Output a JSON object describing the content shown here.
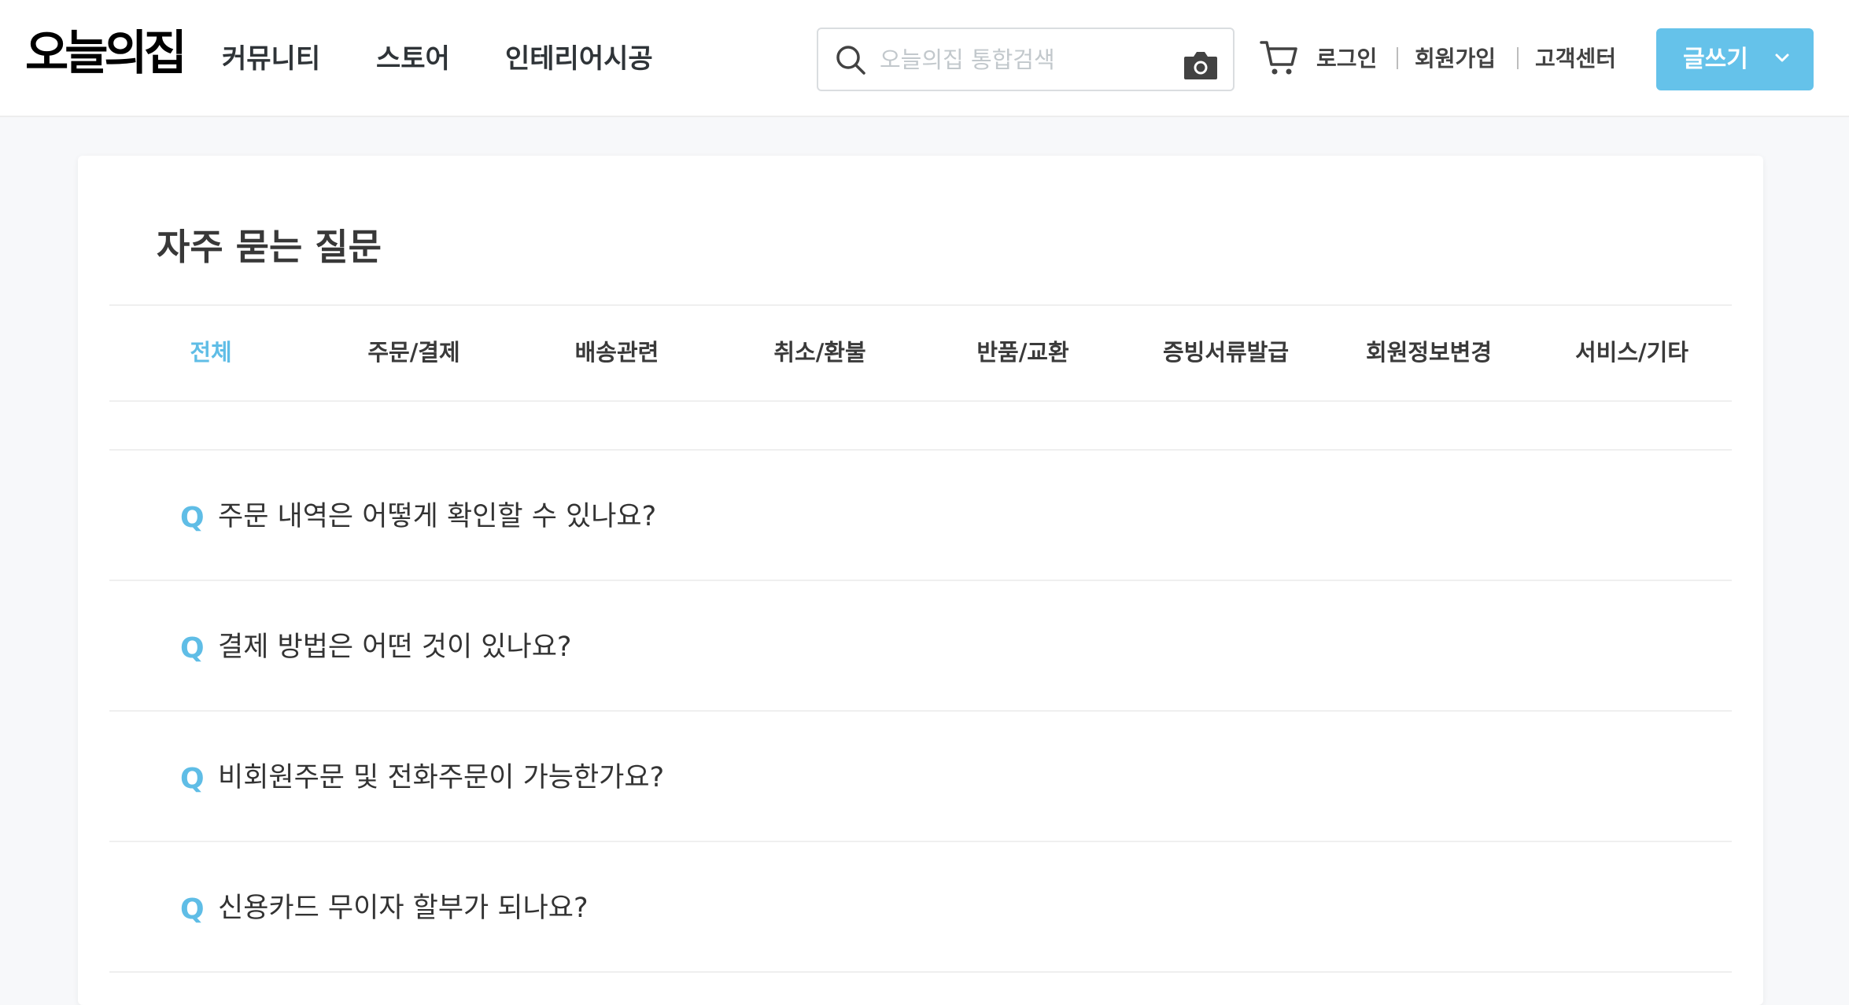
{
  "header": {
    "logo": "오늘의집",
    "nav": [
      "커뮤니티",
      "스토어",
      "인테리어시공"
    ],
    "search_placeholder": "오늘의집 통합검색",
    "links": {
      "login": "로그인",
      "signup": "회원가입",
      "support": "고객센터"
    },
    "write_button": "글쓰기"
  },
  "faq": {
    "title": "자주 묻는 질문",
    "tabs": [
      "전체",
      "주문/결제",
      "배송관련",
      "취소/환불",
      "반품/교환",
      "증빙서류발급",
      "회원정보변경",
      "서비스/기타"
    ],
    "active_tab": "전체",
    "q_marker": "Q",
    "questions": [
      "주문 내역은 어떻게 확인할 수 있나요?",
      "결제 방법은 어떤 것이 있나요?",
      "비회원주문 및 전화주문이 가능한가요?",
      "신용카드 무이자 할부가 되나요?"
    ]
  },
  "colors": {
    "accent": "#65c2ea",
    "active_tab": "#5fbde6",
    "text": "#292929"
  },
  "icons": [
    "search-icon",
    "camera-icon",
    "cart-icon",
    "chevron-down-icon"
  ]
}
